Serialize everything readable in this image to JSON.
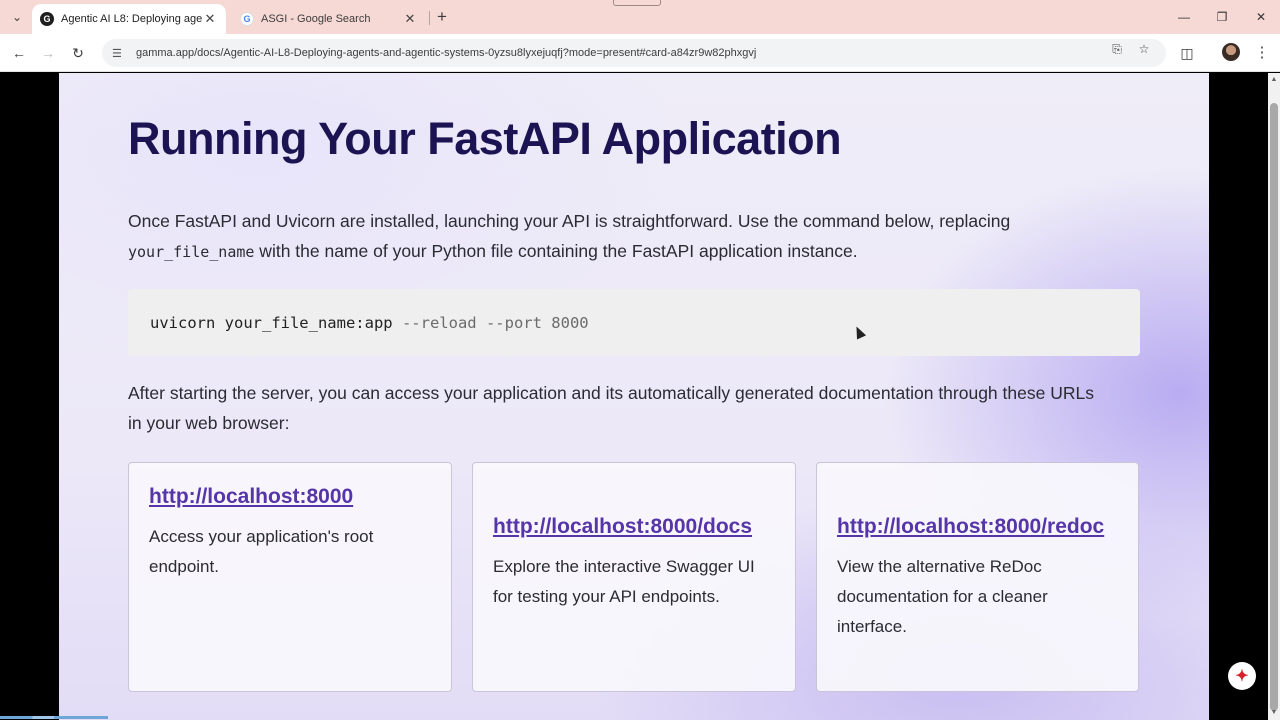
{
  "browser": {
    "tabs": [
      {
        "title": "Agentic AI L8: Deploying agent",
        "active": true,
        "favicon": "gamma-favicon"
      },
      {
        "title": "ASGI - Google Search",
        "active": false,
        "favicon": "google-favicon"
      }
    ],
    "url": "gamma.app/docs/Agentic-AI-L8-Deploying-agents-and-agentic-systems-0yzsu8lyxejuqfj?mode=present#card-a84zr9w82phxgvj",
    "icons": {
      "favicon_gamma": "G",
      "favicon_google": "G",
      "pdf": "pdf-icon"
    }
  },
  "slide": {
    "heading": "Running Your FastAPI Application",
    "intro_part1": "Once FastAPI and Uvicorn are installed, launching your API is straightforward. Use the command below, replacing",
    "intro_code": "your_file_name",
    "intro_part2": " with the name of your Python file containing the FastAPI application instance.",
    "command_main": "uvicorn your_file_name:app",
    "command_flags": " --reload --port 8000",
    "after_text": "After starting the server, you can access your application and its automatically generated documentation through these URLs in your web browser:",
    "links": [
      {
        "url": "http://localhost:8000",
        "description": "Access your application's root endpoint."
      },
      {
        "url": "http://localhost:8000/docs",
        "description": "Explore the interactive Swagger UI for testing your API endpoints."
      },
      {
        "url": "http://localhost:8000/redoc",
        "description": "View the alternative ReDoc documentation for a cleaner interface."
      }
    ]
  },
  "colors": {
    "heading": "#1c1452",
    "link": "#5535a8",
    "tabstrip": "#f6d9d4"
  }
}
